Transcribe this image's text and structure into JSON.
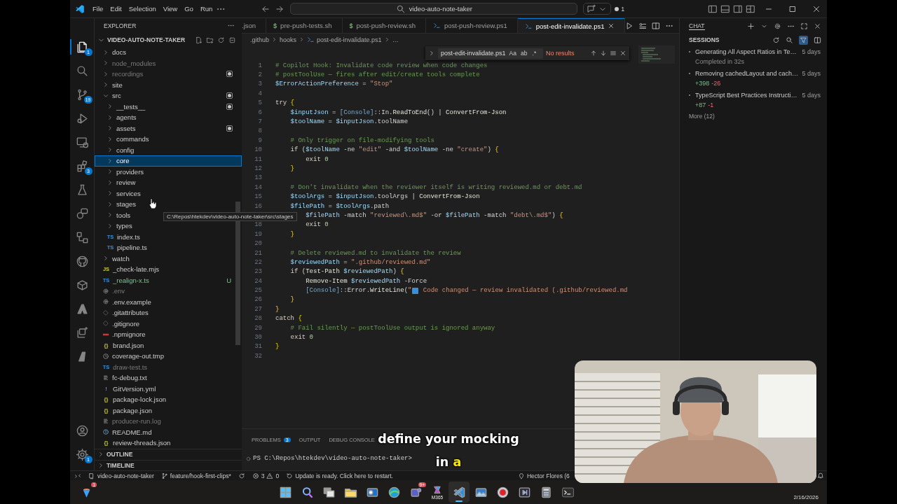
{
  "title_bar": {
    "menu": [
      "File",
      "Edit",
      "Selection",
      "View",
      "Go",
      "Run"
    ],
    "command_center": "video-auto-note-taker",
    "notification_count": "1"
  },
  "activity_bar": {
    "top": [
      {
        "kind": "files",
        "badge": "1",
        "selected": true
      },
      {
        "kind": "search",
        "selected": false
      },
      {
        "kind": "branch",
        "badge": "19",
        "selected": false
      },
      {
        "kind": "debug",
        "selected": false
      },
      {
        "kind": "remote",
        "selected": false
      },
      {
        "kind": "extensions",
        "badge": "3",
        "selected": false
      },
      {
        "kind": "flask",
        "selected": false
      },
      {
        "kind": "chat",
        "selected": false
      },
      {
        "kind": "nodes",
        "selected": false
      },
      {
        "kind": "github",
        "selected": false
      },
      {
        "kind": "cube",
        "selected": false
      },
      {
        "kind": "peak",
        "selected": false
      },
      {
        "kind": "sparkle",
        "selected": false
      },
      {
        "kind": "shard",
        "selected": false
      }
    ],
    "bottom": [
      {
        "kind": "account",
        "selected": false
      },
      {
        "kind": "gear",
        "badge": "1",
        "selected": false
      }
    ]
  },
  "sidebar": {
    "title": "EXPLORER",
    "folder": "VIDEO-AUTO-NOTE-TAKER",
    "items": [
      {
        "label": "docs",
        "kind": "folder",
        "expanded": false,
        "selected": false,
        "dimmed": false,
        "modified": false
      },
      {
        "label": "node_modules",
        "kind": "folder",
        "expanded": false,
        "selected": false,
        "dimmed": true,
        "modified": false
      },
      {
        "label": "recordings",
        "kind": "folder",
        "expanded": false,
        "selected": false,
        "dimmed": true,
        "modified": true
      },
      {
        "label": "site",
        "kind": "folder",
        "expanded": false,
        "selected": false,
        "dimmed": false,
        "modified": false
      },
      {
        "label": "src",
        "kind": "folder",
        "expanded": true,
        "selected": false,
        "dimmed": false,
        "modified": true,
        "children": [
          {
            "label": "__tests__",
            "kind": "folder",
            "expanded": false,
            "selected": false,
            "dimmed": false,
            "modified": true
          },
          {
            "label": "agents",
            "kind": "folder",
            "expanded": false,
            "selected": false,
            "dimmed": false,
            "modified": false
          },
          {
            "label": "assets",
            "kind": "folder",
            "expanded": false,
            "selected": false,
            "dimmed": false,
            "modified": true
          },
          {
            "label": "commands",
            "kind": "folder",
            "expanded": false,
            "selected": false,
            "dimmed": false,
            "modified": false
          },
          {
            "label": "config",
            "kind": "folder",
            "expanded": false,
            "selected": false,
            "dimmed": false,
            "modified": false
          },
          {
            "label": "core",
            "kind": "folder",
            "expanded": false,
            "selected": true,
            "dimmed": false,
            "modified": false
          },
          {
            "label": "providers",
            "kind": "folder",
            "expanded": false,
            "selected": false,
            "dimmed": false,
            "modified": false
          },
          {
            "label": "review",
            "kind": "folder",
            "expanded": false,
            "selected": false,
            "dimmed": false,
            "modified": false
          },
          {
            "label": "services",
            "kind": "folder",
            "expanded": false,
            "selected": false,
            "dimmed": false,
            "modified": false
          },
          {
            "label": "stages",
            "kind": "folder",
            "expanded": false,
            "selected": false,
            "dimmed": false,
            "modified": false
          },
          {
            "label": "tools",
            "kind": "folder",
            "expanded": false,
            "selected": false,
            "dimmed": false,
            "modified": false
          },
          {
            "label": "types",
            "kind": "folder",
            "expanded": false,
            "selected": false,
            "dimmed": false,
            "modified": false
          },
          {
            "label": "index.ts",
            "kind": "ts",
            "icon_text": "TS",
            "selected": false,
            "dimmed": false,
            "modified": false
          },
          {
            "label": "pipeline.ts",
            "kind": "ts",
            "icon_text": "TS",
            "selected": false,
            "dimmed": false,
            "modified": false
          }
        ]
      },
      {
        "label": "watch",
        "kind": "folder",
        "expanded": false,
        "selected": false,
        "dimmed": false,
        "modified": false
      },
      {
        "label": "_check-late.mjs",
        "kind": "js",
        "icon_text": "JS",
        "selected": false,
        "dimmed": false,
        "modified": false
      },
      {
        "label": "_realign-x.ts",
        "kind": "ts",
        "icon_text": "TS",
        "status": "U",
        "selected": false,
        "dimmed": false,
        "modified": false
      },
      {
        "label": ".env",
        "kind": "config",
        "selected": false,
        "dimmed": true,
        "modified": false
      },
      {
        "label": ".env.example",
        "kind": "config",
        "selected": false,
        "dimmed": false,
        "modified": false
      },
      {
        "label": ".gitattributes",
        "kind": "git",
        "selected": false,
        "dimmed": false,
        "modified": false
      },
      {
        "label": ".gitignore",
        "kind": "git",
        "selected": false,
        "dimmed": false,
        "modified": false
      },
      {
        "label": ".npmignore",
        "kind": "npm",
        "selected": false,
        "dimmed": false,
        "modified": false
      },
      {
        "label": "brand.json",
        "kind": "json",
        "icon_text": "{}",
        "selected": false,
        "dimmed": false,
        "modified": false
      },
      {
        "label": "coverage-out.tmp",
        "kind": "tmp",
        "selected": false,
        "dimmed": false,
        "modified": false
      },
      {
        "label": "draw-test.ts",
        "kind": "ts",
        "icon_text": "TS",
        "selected": false,
        "dimmed": true,
        "modified": false
      },
      {
        "label": "fc-debug.txt",
        "kind": "text",
        "selected": false,
        "dimmed": false,
        "modified": false
      },
      {
        "label": "GitVersion.yml",
        "kind": "yaml",
        "icon_text": "!",
        "selected": false,
        "dimmed": false,
        "modified": false
      },
      {
        "label": "package-lock.json",
        "kind": "json",
        "icon_text": "{}",
        "selected": false,
        "dimmed": false,
        "modified": false
      },
      {
        "label": "package.json",
        "kind": "json",
        "icon_text": "{}",
        "selected": false,
        "dimmed": false,
        "modified": false
      },
      {
        "label": "producer-run.log",
        "kind": "text",
        "selected": false,
        "dimmed": true,
        "modified": false
      },
      {
        "label": "README.md",
        "kind": "info",
        "selected": false,
        "dimmed": false,
        "modified": false
      },
      {
        "label": "review-threads.json",
        "kind": "json",
        "icon_text": "{}",
        "selected": false,
        "dimmed": false,
        "modified": false
      }
    ],
    "sections": [
      "OUTLINE",
      "TIMELINE"
    ],
    "tooltip": "C:\\Repos\\htekdev\\video-auto-note-taker\\src\\stages"
  },
  "editor": {
    "tabs": [
      {
        "label": ".json",
        "kind": "json",
        "selected": false
      },
      {
        "label": "pre-push-tests.sh",
        "kind": "sh",
        "icon_text": "$",
        "selected": false
      },
      {
        "label": "post-push-review.sh",
        "kind": "sh",
        "icon_text": "$",
        "selected": false
      },
      {
        "label": "post-push-review.ps1",
        "kind": "ps1",
        "selected": false
      },
      {
        "label": "post-edit-invalidate.ps1",
        "kind": "ps1",
        "selected": true
      }
    ],
    "breadcrumb": [
      {
        "label": ".github",
        "kind": "folder"
      },
      {
        "label": "hooks",
        "kind": "folder"
      },
      {
        "label": "post-edit-invalidate.ps1",
        "kind": "ps1"
      },
      {
        "label": "…",
        "kind": "more"
      }
    ],
    "find": {
      "value": "post-edit-invalidate.ps1",
      "options": [
        "Aa",
        "ab",
        ".*"
      ],
      "result": "No results"
    },
    "lines": [
      {
        "number": "1",
        "tokens": [
          {
            "kind": "comment",
            "text": "# Copilot Hook: Invalidate code review when code changes"
          }
        ]
      },
      {
        "number": "2",
        "tokens": [
          {
            "kind": "comment",
            "text": "# postToolUse — fires after edit/create tools complete"
          }
        ]
      },
      {
        "number": "3",
        "tokens": [
          {
            "kind": "variable",
            "text": "$ErrorActionPreference"
          },
          {
            "kind": "plain",
            "text": " = "
          },
          {
            "kind": "string",
            "text": "\"Stop\""
          }
        ]
      },
      {
        "number": "4"
      },
      {
        "number": "5",
        "tokens": [
          {
            "kind": "keyword",
            "text": "try"
          },
          {
            "kind": "brace",
            "text": " {"
          }
        ]
      },
      {
        "number": "6",
        "tokens": [
          {
            "kind": "variable",
            "text": "    $inputJson"
          },
          {
            "kind": "plain",
            "text": " = "
          },
          {
            "kind": "type",
            "text": "[Console]"
          },
          {
            "kind": "plain",
            "text": "::In."
          },
          {
            "kind": "function",
            "text": "ReadToEnd"
          },
          {
            "kind": "plain",
            "text": "() | "
          },
          {
            "kind": "function",
            "text": "ConvertFrom-Json"
          }
        ]
      },
      {
        "number": "7",
        "tokens": [
          {
            "kind": "variable",
            "text": "    $toolName"
          },
          {
            "kind": "plain",
            "text": " = "
          },
          {
            "kind": "variable",
            "text": "$inputJson"
          },
          {
            "kind": "plain",
            "text": ".toolName"
          }
        ]
      },
      {
        "number": "8"
      },
      {
        "number": "9",
        "tokens": [
          {
            "kind": "comment",
            "text": "    # Only trigger on file-modifying tools"
          }
        ]
      },
      {
        "number": "10",
        "tokens": [
          {
            "kind": "keyword",
            "text": "    if"
          },
          {
            "kind": "plain",
            "text": " ("
          },
          {
            "kind": "variable",
            "text": "$toolName"
          },
          {
            "kind": "plain",
            "text": " -ne "
          },
          {
            "kind": "string",
            "text": "\"edit\""
          },
          {
            "kind": "plain",
            "text": " -and "
          },
          {
            "kind": "variable",
            "text": "$toolName"
          },
          {
            "kind": "plain",
            "text": " -ne "
          },
          {
            "kind": "string",
            "text": "\"create\""
          },
          {
            "kind": "plain",
            "text": ") "
          },
          {
            "kind": "brace",
            "text": "{"
          }
        ]
      },
      {
        "number": "11",
        "tokens": [
          {
            "kind": "keyword",
            "text": "        exit"
          },
          {
            "kind": "number",
            "text": " 0"
          }
        ]
      },
      {
        "number": "12",
        "tokens": [
          {
            "kind": "brace",
            "text": "    }"
          }
        ]
      },
      {
        "number": "13"
      },
      {
        "number": "14",
        "tokens": [
          {
            "kind": "comment",
            "text": "    # Don't invalidate when the reviewer itself is writing reviewed.md or debt.md"
          }
        ]
      },
      {
        "number": "15",
        "tokens": [
          {
            "kind": "variable",
            "text": "    $toolArgs"
          },
          {
            "kind": "plain",
            "text": " = "
          },
          {
            "kind": "variable",
            "text": "$inputJson"
          },
          {
            "kind": "plain",
            "text": ".toolArgs | "
          },
          {
            "kind": "function",
            "text": "ConvertFrom-Json"
          }
        ]
      },
      {
        "number": "16",
        "tokens": [
          {
            "kind": "variable",
            "text": "    $filePath"
          },
          {
            "kind": "plain",
            "text": " = "
          },
          {
            "kind": "variable",
            "text": "$toolArgs"
          },
          {
            "kind": "plain",
            "text": ".path"
          }
        ]
      },
      {
        "tokens": [
          {
            "kind": "variable",
            "text": "        $filePath"
          },
          {
            "kind": "plain",
            "text": " -match "
          },
          {
            "kind": "string",
            "text": "\"reviewed\\.md$\""
          },
          {
            "kind": "plain",
            "text": " -or "
          },
          {
            "kind": "variable",
            "text": "$filePath"
          },
          {
            "kind": "plain",
            "text": " -match "
          },
          {
            "kind": "string",
            "text": "\"debt\\.md$\""
          },
          {
            "kind": "plain",
            "text": ") "
          },
          {
            "kind": "brace",
            "text": "{"
          }
        ]
      },
      {
        "number": "18",
        "tokens": [
          {
            "kind": "keyword",
            "text": "        exit"
          },
          {
            "kind": "number",
            "text": " 0"
          }
        ]
      },
      {
        "number": "19",
        "tokens": [
          {
            "kind": "brace",
            "text": "    }"
          }
        ]
      },
      {
        "number": "20"
      },
      {
        "number": "21",
        "tokens": [
          {
            "kind": "comment",
            "text": "    # Delete reviewed.md to invalidate the review"
          }
        ]
      },
      {
        "number": "22",
        "tokens": [
          {
            "kind": "variable",
            "text": "    $reviewedPath"
          },
          {
            "kind": "plain",
            "text": " = "
          },
          {
            "kind": "string",
            "text": "\".github/reviewed.md\""
          }
        ]
      },
      {
        "number": "23",
        "tokens": [
          {
            "kind": "keyword",
            "text": "    if"
          },
          {
            "kind": "plain",
            "text": " ("
          },
          {
            "kind": "function",
            "text": "Test-Path"
          },
          {
            "kind": "variable",
            "text": " $reviewedPath"
          },
          {
            "kind": "plain",
            "text": ") "
          },
          {
            "kind": "brace",
            "text": "{"
          }
        ]
      },
      {
        "number": "24",
        "tokens": [
          {
            "kind": "function",
            "text": "        Remove-Item"
          },
          {
            "kind": "variable",
            "text": " $reviewedPath"
          },
          {
            "kind": "plain",
            "text": " -Force"
          }
        ]
      },
      {
        "number": "25",
        "tokens": [
          {
            "kind": "type",
            "text": "        [Console]"
          },
          {
            "kind": "plain",
            "text": "::Error."
          },
          {
            "kind": "function",
            "text": "WriteLine"
          },
          {
            "kind": "plain",
            "text": "("
          },
          {
            "kind": "string",
            "text": "\""
          },
          {
            "kind": "icon"
          },
          {
            "kind": "string",
            "text": " Code changed — review invalidated (.github/reviewed.md"
          }
        ]
      },
      {
        "number": "26",
        "tokens": [
          {
            "kind": "brace",
            "text": "    }"
          }
        ]
      },
      {
        "number": "27",
        "tokens": [
          {
            "kind": "brace",
            "text": "}"
          }
        ]
      },
      {
        "number": "28",
        "tokens": [
          {
            "kind": "keyword",
            "text": "catch"
          },
          {
            "kind": "brace",
            "text": " {"
          }
        ]
      },
      {
        "number": "29",
        "tokens": [
          {
            "kind": "comment",
            "text": "    # Fail silently — postToolUse output is ignored anyway"
          }
        ]
      },
      {
        "number": "30",
        "tokens": [
          {
            "kind": "keyword",
            "text": "    exit"
          },
          {
            "kind": "number",
            "text": " 0"
          }
        ]
      },
      {
        "number": "31",
        "tokens": [
          {
            "kind": "brace",
            "text": "}"
          }
        ]
      },
      {
        "number": "32"
      }
    ]
  },
  "panel": {
    "tabs": [
      {
        "label": "PROBLEMS",
        "badge": "3"
      },
      {
        "label": "OUTPUT"
      },
      {
        "label": "DEBUG CONSOLE"
      }
    ],
    "terminal": "PS C:\\Repos\\htekdev\\video-auto-note-taker>"
  },
  "chat": {
    "tab": "CHAT",
    "section": "SESSIONS",
    "sessions": [
      {
        "title": "Generating All Aspect Ratios in Te…",
        "time": "5 days",
        "detail": "Completed in 32s"
      },
      {
        "title": "Removing cachedLayout and cach…",
        "time": "5 days",
        "added": "+398",
        "removed": "-26"
      },
      {
        "title": "TypeScript Best Practices Instructi…",
        "time": "5 days",
        "added": "+87",
        "removed": "-1"
      }
    ],
    "more": "More (12)"
  },
  "status_bar": {
    "workspace": "video-auto-note-taker",
    "branch": "feature/hook-first-clips*",
    "errors": "3",
    "warnings": "0",
    "update": "Update is ready. Click here to restart.",
    "account": "Hector Flores (6"
  },
  "taskbar": {
    "widget_badge": "1",
    "items": [
      {
        "kind": "start",
        "selected": false
      },
      {
        "kind": "search",
        "selected": false
      },
      {
        "kind": "taskview",
        "selected": false
      },
      {
        "kind": "folder",
        "selected": false
      },
      {
        "kind": "mail",
        "selected": false
      },
      {
        "kind": "browser",
        "selected": false
      },
      {
        "kind": "teams",
        "badge": "9+",
        "selected": false
      },
      {
        "kind": "office",
        "label": "M365",
        "selected": false
      },
      {
        "kind": "code",
        "selected": true
      },
      {
        "kind": "photos",
        "selected": false
      },
      {
        "kind": "record",
        "selected": false
      },
      {
        "kind": "media",
        "selected": false
      },
      {
        "kind": "calculator",
        "selected": false
      },
      {
        "kind": "terminal",
        "selected": false
      }
    ],
    "date": "2/16/2026"
  },
  "caption": {
    "lines": [
      [
        {
          "text": "define your mocking",
          "highlight": false
        }
      ],
      [
        {
          "text": "in ",
          "highlight": false
        },
        {
          "text": "a",
          "highlight": true
        }
      ]
    ]
  }
}
